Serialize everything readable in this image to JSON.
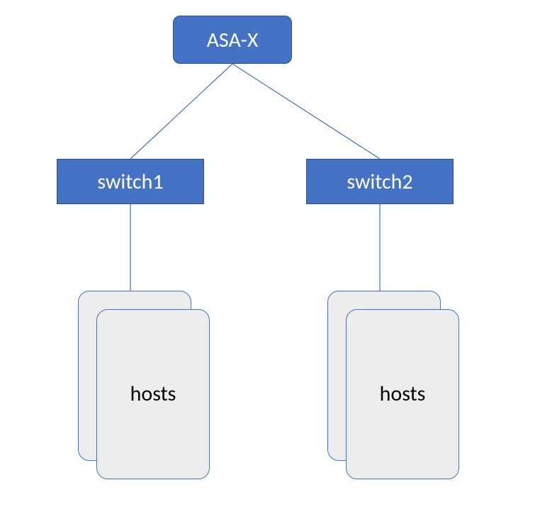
{
  "diagram": {
    "root": {
      "label": "ASA-X"
    },
    "switches": [
      {
        "label": "switch1"
      },
      {
        "label": "switch2"
      }
    ],
    "hostGroups": [
      {
        "label": "hosts"
      },
      {
        "label": "hosts"
      }
    ]
  }
}
